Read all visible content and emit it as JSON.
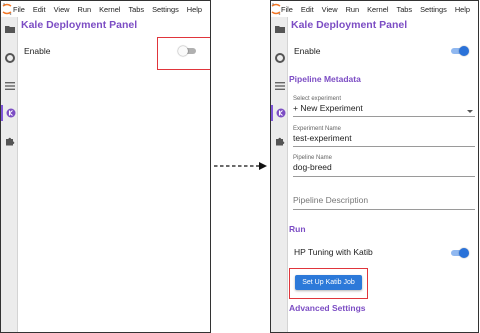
{
  "menu": [
    "File",
    "Edit",
    "View",
    "Run",
    "Kernel",
    "Tabs",
    "Settings",
    "Help"
  ],
  "before": {
    "title": "Kale Deployment Panel",
    "enable_label": "Enable",
    "enable_toggle": false
  },
  "after": {
    "title": "Kale Deployment Panel",
    "enable_label": "Enable",
    "enable_toggle": true,
    "pipeline_metadata_heading": "Pipeline Metadata",
    "select_experiment_label": "Select experiment",
    "select_experiment_value": "+ New Experiment",
    "experiment_name_label": "Experiment Name",
    "experiment_name_value": "test-experiment",
    "pipeline_name_label": "Pipeline Name",
    "pipeline_name_value": "dog-breed",
    "pipeline_description_placeholder": "Pipeline Description",
    "run_heading": "Run",
    "hp_tuning_label": "HP Tuning with Katib",
    "hp_tuning_toggle": true,
    "katib_button_label": "Set Up Katib Job",
    "advanced_settings_heading": "Advanced Settings"
  },
  "colors": {
    "accent_purple": "#7c4dc4",
    "toggle_blue": "#2a72d9",
    "button_blue": "#2c79d9",
    "highlight_red": "#e0353b"
  },
  "icons": [
    "jupyter-logo-icon",
    "folder-icon",
    "running-icon",
    "list-icon",
    "kale-icon",
    "extension-icon",
    "dashed-arrow-icon"
  ]
}
